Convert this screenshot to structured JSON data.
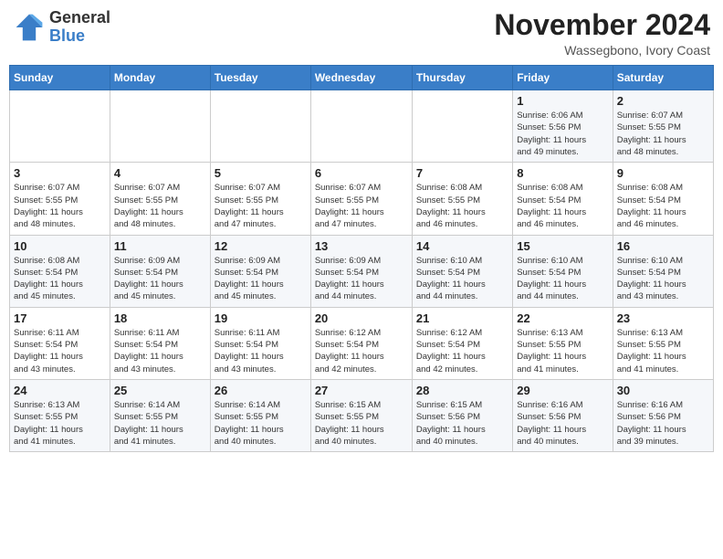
{
  "header": {
    "logo_general": "General",
    "logo_blue": "Blue",
    "month": "November 2024",
    "location": "Wassegbono, Ivory Coast"
  },
  "weekdays": [
    "Sunday",
    "Monday",
    "Tuesday",
    "Wednesday",
    "Thursday",
    "Friday",
    "Saturday"
  ],
  "weeks": [
    [
      {
        "day": "",
        "info": ""
      },
      {
        "day": "",
        "info": ""
      },
      {
        "day": "",
        "info": ""
      },
      {
        "day": "",
        "info": ""
      },
      {
        "day": "",
        "info": ""
      },
      {
        "day": "1",
        "info": "Sunrise: 6:06 AM\nSunset: 5:56 PM\nDaylight: 11 hours\nand 49 minutes."
      },
      {
        "day": "2",
        "info": "Sunrise: 6:07 AM\nSunset: 5:55 PM\nDaylight: 11 hours\nand 48 minutes."
      }
    ],
    [
      {
        "day": "3",
        "info": "Sunrise: 6:07 AM\nSunset: 5:55 PM\nDaylight: 11 hours\nand 48 minutes."
      },
      {
        "day": "4",
        "info": "Sunrise: 6:07 AM\nSunset: 5:55 PM\nDaylight: 11 hours\nand 48 minutes."
      },
      {
        "day": "5",
        "info": "Sunrise: 6:07 AM\nSunset: 5:55 PM\nDaylight: 11 hours\nand 47 minutes."
      },
      {
        "day": "6",
        "info": "Sunrise: 6:07 AM\nSunset: 5:55 PM\nDaylight: 11 hours\nand 47 minutes."
      },
      {
        "day": "7",
        "info": "Sunrise: 6:08 AM\nSunset: 5:55 PM\nDaylight: 11 hours\nand 46 minutes."
      },
      {
        "day": "8",
        "info": "Sunrise: 6:08 AM\nSunset: 5:54 PM\nDaylight: 11 hours\nand 46 minutes."
      },
      {
        "day": "9",
        "info": "Sunrise: 6:08 AM\nSunset: 5:54 PM\nDaylight: 11 hours\nand 46 minutes."
      }
    ],
    [
      {
        "day": "10",
        "info": "Sunrise: 6:08 AM\nSunset: 5:54 PM\nDaylight: 11 hours\nand 45 minutes."
      },
      {
        "day": "11",
        "info": "Sunrise: 6:09 AM\nSunset: 5:54 PM\nDaylight: 11 hours\nand 45 minutes."
      },
      {
        "day": "12",
        "info": "Sunrise: 6:09 AM\nSunset: 5:54 PM\nDaylight: 11 hours\nand 45 minutes."
      },
      {
        "day": "13",
        "info": "Sunrise: 6:09 AM\nSunset: 5:54 PM\nDaylight: 11 hours\nand 44 minutes."
      },
      {
        "day": "14",
        "info": "Sunrise: 6:10 AM\nSunset: 5:54 PM\nDaylight: 11 hours\nand 44 minutes."
      },
      {
        "day": "15",
        "info": "Sunrise: 6:10 AM\nSunset: 5:54 PM\nDaylight: 11 hours\nand 44 minutes."
      },
      {
        "day": "16",
        "info": "Sunrise: 6:10 AM\nSunset: 5:54 PM\nDaylight: 11 hours\nand 43 minutes."
      }
    ],
    [
      {
        "day": "17",
        "info": "Sunrise: 6:11 AM\nSunset: 5:54 PM\nDaylight: 11 hours\nand 43 minutes."
      },
      {
        "day": "18",
        "info": "Sunrise: 6:11 AM\nSunset: 5:54 PM\nDaylight: 11 hours\nand 43 minutes."
      },
      {
        "day": "19",
        "info": "Sunrise: 6:11 AM\nSunset: 5:54 PM\nDaylight: 11 hours\nand 43 minutes."
      },
      {
        "day": "20",
        "info": "Sunrise: 6:12 AM\nSunset: 5:54 PM\nDaylight: 11 hours\nand 42 minutes."
      },
      {
        "day": "21",
        "info": "Sunrise: 6:12 AM\nSunset: 5:54 PM\nDaylight: 11 hours\nand 42 minutes."
      },
      {
        "day": "22",
        "info": "Sunrise: 6:13 AM\nSunset: 5:55 PM\nDaylight: 11 hours\nand 41 minutes."
      },
      {
        "day": "23",
        "info": "Sunrise: 6:13 AM\nSunset: 5:55 PM\nDaylight: 11 hours\nand 41 minutes."
      }
    ],
    [
      {
        "day": "24",
        "info": "Sunrise: 6:13 AM\nSunset: 5:55 PM\nDaylight: 11 hours\nand 41 minutes."
      },
      {
        "day": "25",
        "info": "Sunrise: 6:14 AM\nSunset: 5:55 PM\nDaylight: 11 hours\nand 41 minutes."
      },
      {
        "day": "26",
        "info": "Sunrise: 6:14 AM\nSunset: 5:55 PM\nDaylight: 11 hours\nand 40 minutes."
      },
      {
        "day": "27",
        "info": "Sunrise: 6:15 AM\nSunset: 5:55 PM\nDaylight: 11 hours\nand 40 minutes."
      },
      {
        "day": "28",
        "info": "Sunrise: 6:15 AM\nSunset: 5:56 PM\nDaylight: 11 hours\nand 40 minutes."
      },
      {
        "day": "29",
        "info": "Sunrise: 6:16 AM\nSunset: 5:56 PM\nDaylight: 11 hours\nand 40 minutes."
      },
      {
        "day": "30",
        "info": "Sunrise: 6:16 AM\nSunset: 5:56 PM\nDaylight: 11 hours\nand 39 minutes."
      }
    ]
  ]
}
